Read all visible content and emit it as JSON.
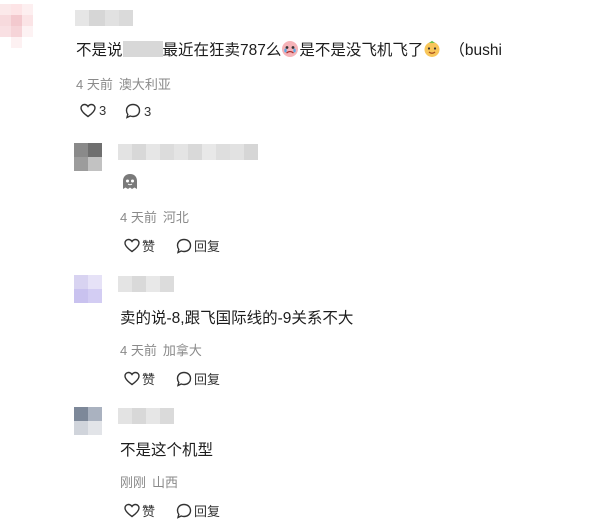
{
  "comments": [
    {
      "id": "top",
      "text_prefix": "不是说",
      "text_mid": "最近在狂卖787么",
      "text_after_emoji": "是不是没飞机飞了",
      "text_suffix": "（bushi",
      "time": "4 天前",
      "location": "澳大利亚",
      "like_count": "3",
      "reply_count": "3",
      "emoji1": "crying-face-icon",
      "emoji2": "smiling-face-icon"
    },
    {
      "id": "reply1",
      "text": "",
      "emoji": "ghost-sticker-icon",
      "time": "4 天前",
      "location": "河北",
      "like_label": "赞",
      "reply_label": "回复"
    },
    {
      "id": "reply2",
      "text": "卖的说-8,跟飞国际线的-9关系不大",
      "time": "4 天前",
      "location": "加拿大",
      "like_label": "赞",
      "reply_label": "回复"
    },
    {
      "id": "reply3",
      "text": "不是这个机型",
      "time": "刚刚",
      "location": "山西",
      "like_label": "赞",
      "reply_label": "回复"
    }
  ],
  "colors": {
    "text": "#1c1c1c",
    "meta": "#8a8a8a",
    "blur_gray": "#d9d9d9"
  }
}
